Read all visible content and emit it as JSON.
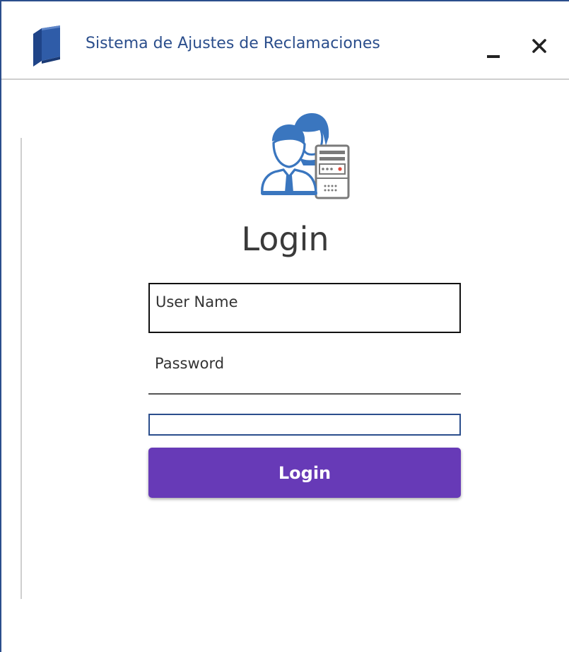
{
  "window": {
    "title": "Sistema de Ajustes de Reclamaciones",
    "minimize_label": "_",
    "close_label": "✕",
    "app_icon": "book-icon"
  },
  "login": {
    "heading": "Login",
    "hero_icon": "users-server-icon",
    "username_placeholder": "User Name",
    "username_value": "",
    "password_placeholder": "Password",
    "password_value": "",
    "extra_field_value": "",
    "button_label": "Login"
  },
  "colors": {
    "accent_blue": "#2b4e8c",
    "icon_blue": "#3a76bf",
    "button_purple": "#673ab7",
    "text_dark": "#3a3a3a"
  }
}
